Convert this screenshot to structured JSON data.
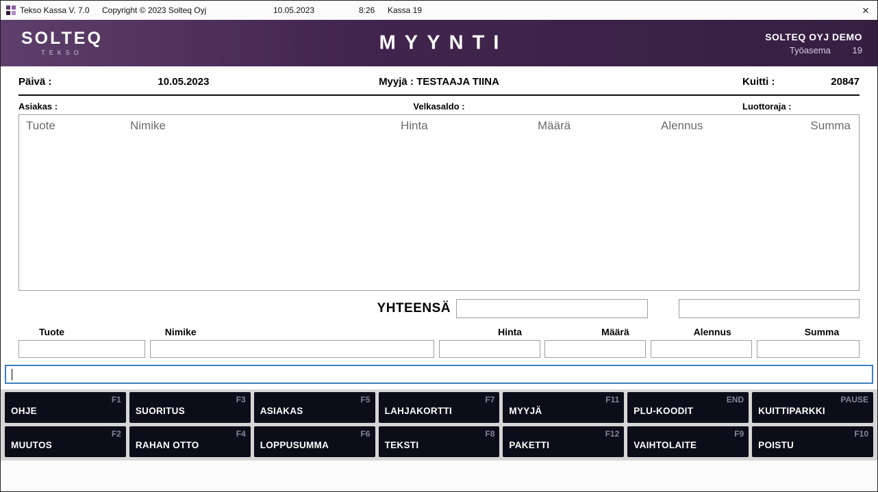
{
  "titlebar": {
    "app_title": "Tekso Kassa V. 7.0",
    "copyright": "Copyright © 2023 Solteq Oyj",
    "date": "10.05.2023",
    "time": "8:26",
    "register": "Kassa 19",
    "close_glyph": "✕"
  },
  "header": {
    "logo_main": "SOLTEQ",
    "logo_sub": "TEKSO",
    "title": "MYYNTI",
    "store": "SOLTEQ OYJ DEMO",
    "workstation_label": "Työasema",
    "workstation_value": "19"
  },
  "info": {
    "date_label": "Päivä :",
    "date_value": "10.05.2023",
    "seller_label": "Myyjä :",
    "seller_value": "TESTAAJA TIINA",
    "receipt_label": "Kuitti :",
    "receipt_value": "20847",
    "customer_label": "Asiakas :",
    "debt_label": "Velkasaldo :",
    "credit_label": "Luottoraja :"
  },
  "table": {
    "columns": [
      "Tuote",
      "Nimike",
      "Hinta",
      "Määrä",
      "Alennus",
      "Summa"
    ],
    "rows": []
  },
  "total": {
    "label": "YHTEENSÄ",
    "value": "",
    "secondary_value": ""
  },
  "entry": {
    "fields": [
      {
        "label": "Tuote",
        "value": ""
      },
      {
        "label": "Nimike",
        "value": ""
      },
      {
        "label": "Hinta",
        "value": ""
      },
      {
        "label": "Määrä",
        "value": ""
      },
      {
        "label": "Alennus",
        "value": ""
      },
      {
        "label": "Summa",
        "value": ""
      }
    ],
    "command_value": ""
  },
  "function_keys": {
    "rows": [
      [
        {
          "label": "OHJE",
          "key": "F1"
        },
        {
          "label": "SUORITUS",
          "key": "F3"
        },
        {
          "label": "ASIAKAS",
          "key": "F5"
        },
        {
          "label": "LAHJAKORTTI",
          "key": "F7"
        },
        {
          "label": "MYYJÄ",
          "key": "F11"
        },
        {
          "label": "PLU-KOODIT",
          "key": "END"
        },
        {
          "label": "KUITTIPARKKI",
          "key": "PAUSE"
        }
      ],
      [
        {
          "label": "MUUTOS",
          "key": "F2"
        },
        {
          "label": "RAHAN OTTO",
          "key": "F4"
        },
        {
          "label": "LOPPUSUMMA",
          "key": "F6"
        },
        {
          "label": "TEKSTI",
          "key": "F8"
        },
        {
          "label": "PAKETTI",
          "key": "F12"
        },
        {
          "label": "VAIHTOLAITE",
          "key": "F9"
        },
        {
          "label": "POISTU",
          "key": "F10"
        }
      ]
    ]
  },
  "colors": {
    "header_gradient_start": "#5e3f6b",
    "header_gradient_end": "#351f41",
    "button_bg": "#0d0d1a",
    "button_key_text": "#85859a",
    "focus_border_blue": "#3d7ebf",
    "table_header_text": "#6a6a6a"
  }
}
